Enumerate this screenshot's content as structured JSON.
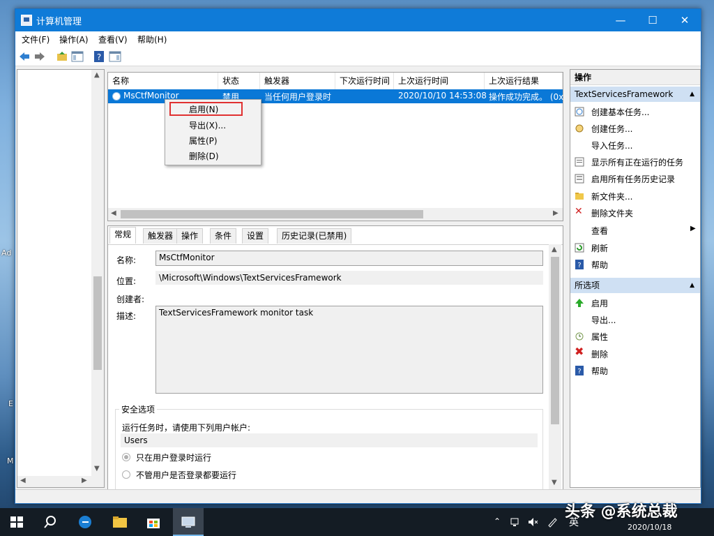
{
  "window": {
    "title": "计算机管理"
  },
  "menus": [
    "文件(F)",
    "操作(A)",
    "查看(V)",
    "帮助(H)"
  ],
  "desktop_fragments": [
    "Ad",
    "E",
    "M"
  ],
  "task_list": {
    "columns": [
      "名称",
      "状态",
      "触发器",
      "下次运行时间",
      "上次运行时间",
      "上次运行结果"
    ],
    "row": {
      "name": "MsCtfMonitor",
      "status": "禁用",
      "trigger": "当任何用户登录时",
      "next_run": "",
      "last_run": "2020/10/10 14:53:08",
      "last_result": "操作成功完成。 (0x"
    }
  },
  "context_menu": [
    "启用(N)",
    "导出(X)...",
    "属性(P)",
    "删除(D)"
  ],
  "details": {
    "tabs": [
      "常规",
      "触发器",
      "操作",
      "条件",
      "设置",
      "历史记录(已禁用)"
    ],
    "name_label": "名称:",
    "name_value": "MsCtfMonitor",
    "location_label": "位置:",
    "location_value": "\\Microsoft\\Windows\\TextServicesFramework",
    "author_label": "创建者:",
    "desc_label": "描述:",
    "desc_value": "TextServicesFramework monitor task",
    "security_title": "安全选项",
    "run_as_label": "运行任务时，请使用下列用户帐户:",
    "run_as_value": "Users",
    "radio1": "只在用户登录时运行",
    "radio2": "不管用户是否登录都要运行"
  },
  "actions": {
    "header": "操作",
    "section1": "TextServicesFramework",
    "items1": [
      "创建基本任务...",
      "创建任务...",
      "导入任务...",
      "显示所有正在运行的任务",
      "启用所有任务历史记录",
      "新文件夹...",
      "删除文件夹",
      "查看",
      "刷新",
      "帮助"
    ],
    "section2": "所选项",
    "items2": [
      "启用",
      "导出...",
      "属性",
      "删除",
      "帮助"
    ]
  },
  "taskbar": {
    "ime": "英",
    "date": "2020/10/18",
    "watermark": "头条 @系统总裁"
  },
  "colors": {
    "titlebar": "#0f7bd8",
    "selection": "#0a78d7",
    "highlight_box": "#e03030"
  }
}
